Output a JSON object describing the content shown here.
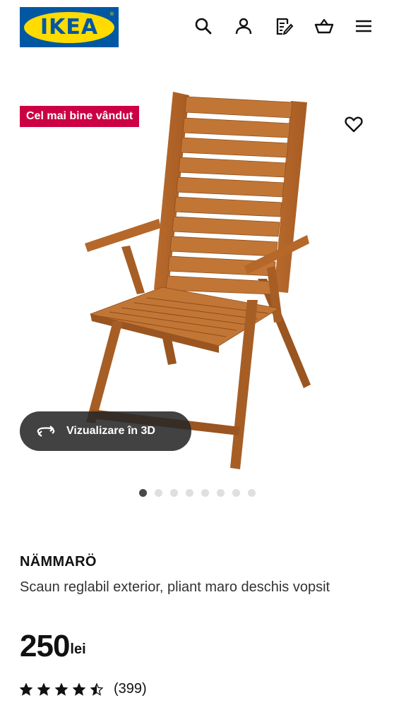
{
  "brand": {
    "logo_text": "IKEA",
    "colors": {
      "blue": "#0058a3",
      "yellow": "#ffdb00"
    }
  },
  "header": {
    "icons": [
      "search-icon",
      "account-icon",
      "shopping-list-icon",
      "cart-icon",
      "menu-icon"
    ]
  },
  "gallery": {
    "badge": "Cel mai bine vândut",
    "badge_color": "#cc0044",
    "view_3d_label": "Vizualizare în 3D",
    "slide_count": 8,
    "active_slide": 1
  },
  "product": {
    "name": "NÄMMARÖ",
    "description": "Scaun reglabil exterior, pliant maro deschis vopsit",
    "price_integer": "250",
    "price_currency": "lei",
    "rating_stars": 4.5,
    "reviews_count": "(399)"
  }
}
